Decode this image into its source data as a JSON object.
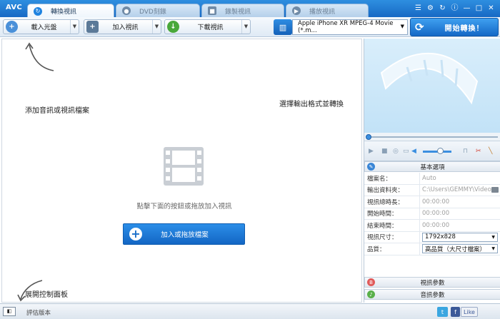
{
  "app": {
    "logo": "AVC"
  },
  "tabs": [
    {
      "label": "轉換視訊",
      "active": true
    },
    {
      "label": "DVD刻錄",
      "active": false
    },
    {
      "label": "錄製視訊",
      "active": false
    },
    {
      "label": "播放視訊",
      "active": false
    }
  ],
  "window_controls": [
    "☰",
    "⚙",
    "↻",
    "ⓘ",
    "—",
    "□",
    "✕"
  ],
  "toolbar": {
    "load_disc": "載入光盤",
    "add_video": "加入視訊",
    "download_video": "下載視訊",
    "format": "Apple iPhone XR MPEG-4 Movie (*.m...",
    "convert": "開始轉換！"
  },
  "main": {
    "hint_add": "添加音訊或視訊檔案",
    "hint_format": "選擇輸出格式並轉換",
    "drop_hint": "點擊下面的按鈕或拖放加入視訊",
    "add_button": "加入或拖放檔案",
    "hint_panel": "展開控制面板"
  },
  "panel": {
    "basic_title": "基本選項",
    "rows": [
      {
        "key": "檔案名：",
        "value": "Auto"
      },
      {
        "key": "輸出資料夾：",
        "value": "C:\\Users\\GEMMY\\Video..."
      },
      {
        "key": "視訊總時長：",
        "value": "00:00:00"
      },
      {
        "key": "開始時間：",
        "value": "00:00:00"
      },
      {
        "key": "結束時間：",
        "value": "00:00:00"
      },
      {
        "key": "視訊尺寸：",
        "value": "1792x828"
      },
      {
        "key": "品質：",
        "value": "高品質（大尺寸檔案）"
      }
    ],
    "video_params": "視訊參數",
    "audio_params": "音訊參數"
  },
  "status": {
    "toggle": "◧",
    "label": "評估版本",
    "twitter": "t",
    "facebook": "f",
    "like": "Like"
  },
  "colors": {
    "accent": "#1769c4",
    "title_bar": "#2e8fe0"
  }
}
